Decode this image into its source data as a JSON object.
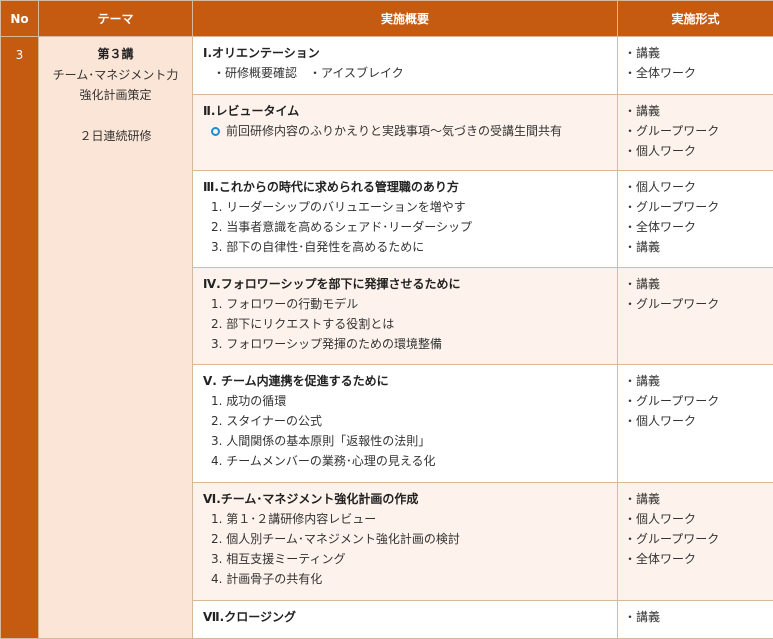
{
  "header": {
    "no": "No",
    "theme": "テーマ",
    "overview": "実施概要",
    "format": "実施形式"
  },
  "row": {
    "no": "3",
    "theme": {
      "title": "第３講",
      "line2": "チーム･マネジメント力",
      "line3": "強化計画策定",
      "line4": "２日連続研修"
    },
    "sections": [
      {
        "title": "Ⅰ.オリエンテーション",
        "lines": [
          "・研修概要確認　・アイスブレイク"
        ],
        "formats": [
          "・講義",
          "・全体ワーク"
        ]
      },
      {
        "title": "Ⅱ.レビュータイム",
        "lines": [
          "前回研修内容のふりかえりと実践事項～気づきの受講生間共有"
        ],
        "formats": [
          "・講義",
          "・グループワーク",
          "・個人ワーク"
        ]
      },
      {
        "title": "Ⅲ.これからの時代に求められる管理職のあり方",
        "lines": [
          "1. リーダーシップのバリュエーションを増やす",
          "2. 当事者意識を高めるシェアド･リーダーシップ",
          "3. 部下の自律性･自発性を高めるために"
        ],
        "formats": [
          "・個人ワーク",
          "・グループワーク",
          "・全体ワーク",
          "・講義"
        ]
      },
      {
        "title": "Ⅳ.フォロワーシップを部下に発揮させるために",
        "lines": [
          "1. フォロワーの行動モデル",
          "2. 部下にリクエストする役割とは",
          "3. フォロワーシップ発揮のための環境整備"
        ],
        "formats": [
          "・講義",
          "・グループワーク"
        ]
      },
      {
        "title": "Ⅴ. チーム内連携を促進するために",
        "lines": [
          "1. 成功の循環",
          "2. スタイナーの公式",
          "3. 人間関係の基本原則「返報性の法則」",
          "4. チームメンバーの業務･心理の見える化"
        ],
        "formats": [
          "・講義",
          "・グループワーク",
          "・個人ワーク"
        ]
      },
      {
        "title": "Ⅵ.チーム･マネジメント強化計画の作成",
        "lines": [
          "1. 第１･２講研修内容レビュー",
          "2. 個人別チーム･マネジメント強化計画の検討",
          "3. 相互支援ミーティング",
          "4. 計画骨子の共有化"
        ],
        "formats": [
          "・講義",
          "・個人ワーク",
          "・グループワーク",
          "・全体ワーク"
        ]
      },
      {
        "title": "Ⅶ.クロージング",
        "lines": [],
        "formats": [
          "・講義"
        ]
      }
    ]
  }
}
